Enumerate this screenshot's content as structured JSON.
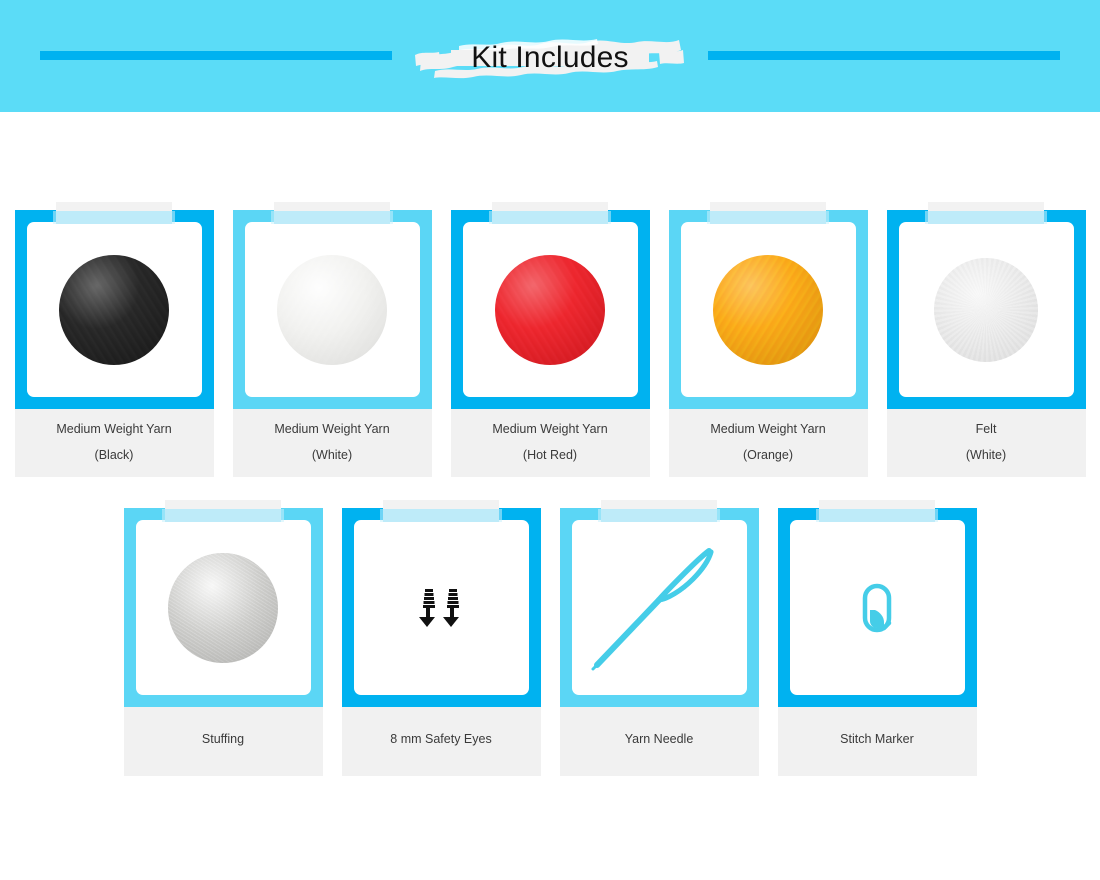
{
  "header": {
    "title": "Kit Includes",
    "background_color": "#5BDCF7",
    "rule_color": "#00B2F0",
    "brush_color": "#f2f2f2"
  },
  "theme": {
    "frame_vivid": "#00B2F0",
    "frame_light": "#5BD6F5",
    "caption_bg": "#f1f1f1",
    "caption_text": "#3a3a3a",
    "card_inner": "#ffffff",
    "page_bg": "#ffffff",
    "accent_turquoise": "#45CDE8"
  },
  "rows": [
    {
      "name": "materials-row",
      "cards": [
        {
          "id": "medium-weight-yarn-black",
          "title": "Medium Weight Yarn",
          "subtitle": "(Black)",
          "frame": "vivid",
          "media": "yarn-swatch",
          "swatch_color": "#1d1d1d",
          "icon_name": "yarn-ball-black"
        },
        {
          "id": "medium-weight-yarn-white",
          "title": "Medium Weight Yarn",
          "subtitle": "(White)",
          "frame": "light",
          "media": "yarn-swatch",
          "swatch_color": "#f3f3f1",
          "icon_name": "yarn-ball-white"
        },
        {
          "id": "medium-weight-yarn-hot-red",
          "title": "Medium Weight Yarn",
          "subtitle": "(Hot Red)",
          "frame": "vivid",
          "media": "yarn-swatch",
          "swatch_color": "#ed1c24",
          "icon_name": "yarn-ball-red"
        },
        {
          "id": "medium-weight-yarn-orange",
          "title": "Medium Weight Yarn",
          "subtitle": "(Orange)",
          "frame": "light",
          "media": "yarn-swatch",
          "swatch_color": "#fba70d",
          "icon_name": "yarn-ball-orange"
        },
        {
          "id": "felt-white",
          "title": "Felt",
          "subtitle": "(White)",
          "frame": "vivid",
          "media": "felt-swatch",
          "swatch_color": "#ebebeb",
          "icon_name": "felt-disc-white"
        }
      ]
    },
    {
      "name": "notions-row",
      "cards": [
        {
          "id": "stuffing",
          "title": "Stuffing",
          "subtitle": "",
          "frame": "light",
          "media": "stuffing-swatch",
          "swatch_color": "#c9c9c7",
          "icon_name": "stuffing-ball"
        },
        {
          "id": "safety-eyes-8mm",
          "title": "8 mm Safety Eyes",
          "subtitle": "",
          "frame": "vivid",
          "media": "safety-eyes",
          "swatch_color": "#111111",
          "icon_name": "safety-eyes-icon"
        },
        {
          "id": "yarn-needle",
          "title": "Yarn Needle",
          "subtitle": "",
          "frame": "light",
          "media": "yarn-needle",
          "swatch_color": "#45CDE8",
          "icon_name": "yarn-needle-icon"
        },
        {
          "id": "stitch-marker",
          "title": "Stitch Marker",
          "subtitle": "",
          "frame": "vivid",
          "media": "stitch-marker",
          "swatch_color": "#45CDE8",
          "icon_name": "stitch-marker-icon"
        }
      ]
    }
  ]
}
